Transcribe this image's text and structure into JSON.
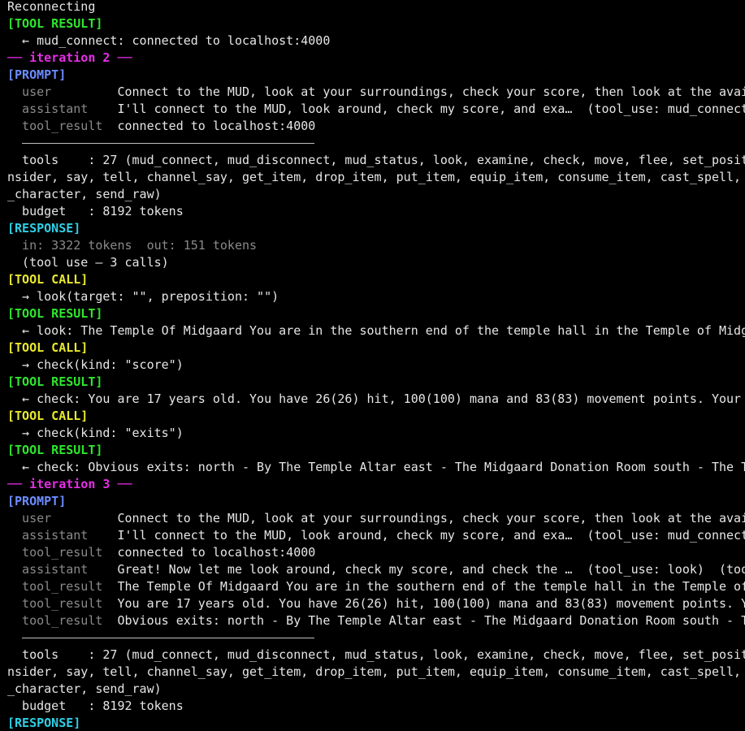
{
  "lines": {
    "reconnecting": "Reconnecting",
    "tool_result_1_tag": "[TOOL RESULT]",
    "tool_result_1_text": "  ← mud_connect: connected to localhost:4000",
    "iter2": "── iteration 2 ──",
    "prompt2_tag": "[PROMPT]",
    "p2_user_role": "  user         ",
    "p2_user_text": "Connect to the MUD, look at your surroundings, check your score, then look at the avai",
    "p2_asst_role": "  assistant    ",
    "p2_asst_text": "I'll connect to the MUD, look around, check my score, and exa…  (tool_use: mud_connect",
    "p2_tr_role": "  tool_result  ",
    "p2_tr_text": "connected to localhost:4000",
    "p2_tools_a": "  tools    : 27 (mud_connect, mud_disconnect, mud_status, look, examine, check, move, flee, set_posit",
    "p2_tools_b": "nsider, say, tell, channel_say, get_item, drop_item, put_item, equip_item, consume_item, cast_spell, ",
    "p2_tools_c": "_character, send_raw)",
    "p2_budget": "  budget   : 8192 tokens",
    "resp2_tag": "[RESPONSE]",
    "resp2_tokens": "  in: 3322 tokens  out: 151 tokens",
    "resp2_tooluse": "  (tool use — 3 calls)",
    "call1_tag": "[TOOL CALL]",
    "call1_text": "  → look(target: \"\", preposition: \"\")",
    "res1_tag": "[TOOL RESULT]",
    "res1_text": "  ← look: The Temple Of Midgaard You are in the southern end of the temple hall in the Temple of Midg",
    "call2_tag": "[TOOL CALL]",
    "call2_text": "  → check(kind: \"score\")",
    "res2_tag": "[TOOL RESULT]",
    "res2_text": "  ← check: You are 17 years old. You have 26(26) hit, 100(100) mana and 83(83) movement points. Your",
    "call3_tag": "[TOOL CALL]",
    "call3_text": "  → check(kind: \"exits\")",
    "res3_tag": "[TOOL RESULT]",
    "res3_text": "  ← check: Obvious exits: north - By The Temple Altar east - The Midgaard Donation Room south - The T",
    "iter3": "── iteration 3 ──",
    "prompt3_tag": "[PROMPT]",
    "p3_user_role": "  user         ",
    "p3_user_text": "Connect to the MUD, look at your surroundings, check your score, then look at the avai",
    "p3_asst1_role": "  assistant    ",
    "p3_asst1_text": "I'll connect to the MUD, look around, check my score, and exa…  (tool_use: mud_connect",
    "p3_tr1_role": "  tool_result  ",
    "p3_tr1_text": "connected to localhost:4000",
    "p3_asst2_role": "  assistant    ",
    "p3_asst2_text": "Great! Now let me look around, check my score, and check the …  (tool_use: look)  (too",
    "p3_tr2_role": "  tool_result  ",
    "p3_tr2_text": "The Temple Of Midgaard You are in the southern end of the temple hall in the Temple of",
    "p3_tr3_role": "  tool_result  ",
    "p3_tr3_text": "You are 17 years old. You have 26(26) hit, 100(100) mana and 83(83) movement points. Y",
    "p3_tr4_role": "  tool_result  ",
    "p3_tr4_text": "Obvious exits: north - By The Temple Altar east - The Midgaard Donation Room south - T",
    "p3_tools_a": "  tools    : 27 (mud_connect, mud_disconnect, mud_status, look, examine, check, move, flee, set_posit",
    "p3_tools_b": "nsider, say, tell, channel_say, get_item, drop_item, put_item, equip_item, consume_item, cast_spell, ",
    "p3_tools_c": "_character, send_raw)",
    "p3_budget": "  budget   : 8192 tokens",
    "resp3_tag": "[RESPONSE]"
  },
  "colors": {
    "background": "#000000",
    "text": "#e6e6e6",
    "tool_result": "#2ee62e",
    "tool_call": "#e8e82e",
    "prompt": "#6b8cff",
    "response": "#2ecfe6",
    "iteration": "#e62ee6",
    "dim": "#8a8a8a"
  }
}
